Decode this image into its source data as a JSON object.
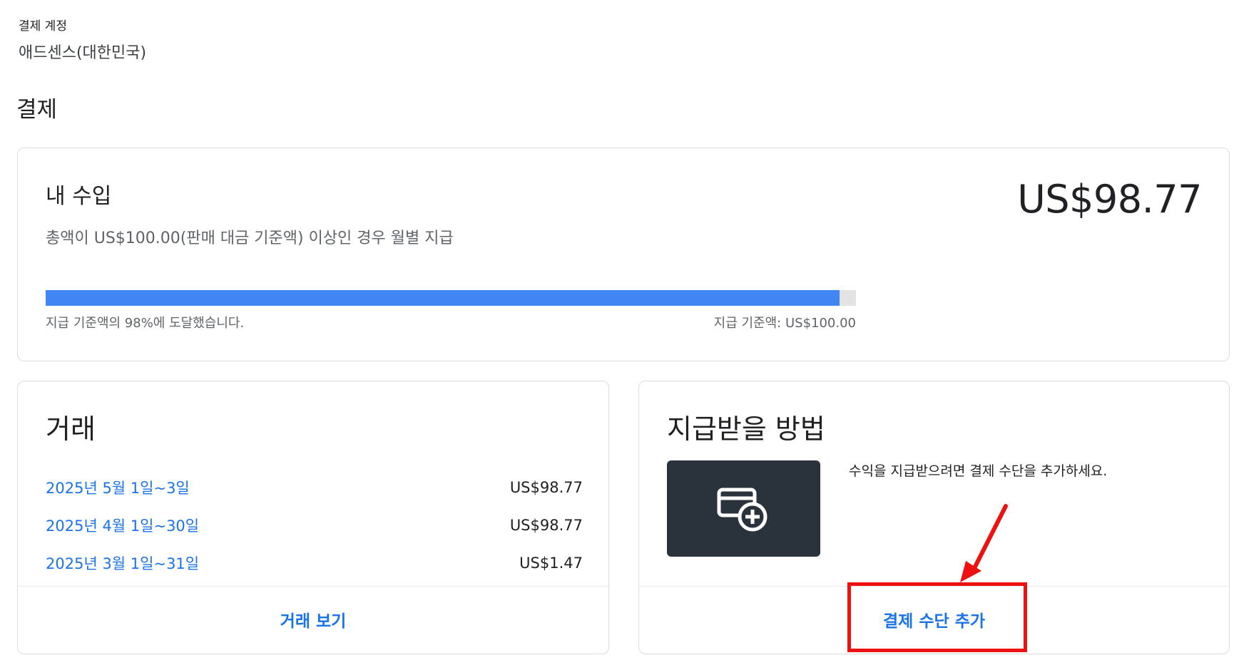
{
  "account": {
    "label": "결제 계정",
    "name": "애드센스(대한민국)"
  },
  "page": {
    "title": "결제"
  },
  "earnings": {
    "title": "내 수입",
    "subtitle": "총액이 US$100.00(판매 대금 기준액) 이상인 경우 월별 지급",
    "amount": "US$98.77",
    "progress_fraction": 0.98,
    "progress_text": "지급 기준액의 98%에 도달했습니다.",
    "threshold_text": "지급 기준액: US$100.00",
    "colors": {
      "progress_fill": "#4285f4",
      "progress_track": "#e3e3e3"
    }
  },
  "transactions": {
    "title": "거래",
    "rows": [
      {
        "date": "2025년 5월 1일~3일",
        "amount": "US$98.77"
      },
      {
        "date": "2025년 4월 1일~30일",
        "amount": "US$98.77"
      },
      {
        "date": "2025년 3월 1일~31일",
        "amount": "US$1.47"
      }
    ],
    "view_label": "거래 보기"
  },
  "payment": {
    "title": "지급받을 방법",
    "icon": "add-card-icon",
    "description": "수익을 지급받으려면 결제 수단을 추가하세요.",
    "add_label": "결제 수단 추가"
  },
  "annotation": {
    "highlight_color": "#ee1111"
  }
}
